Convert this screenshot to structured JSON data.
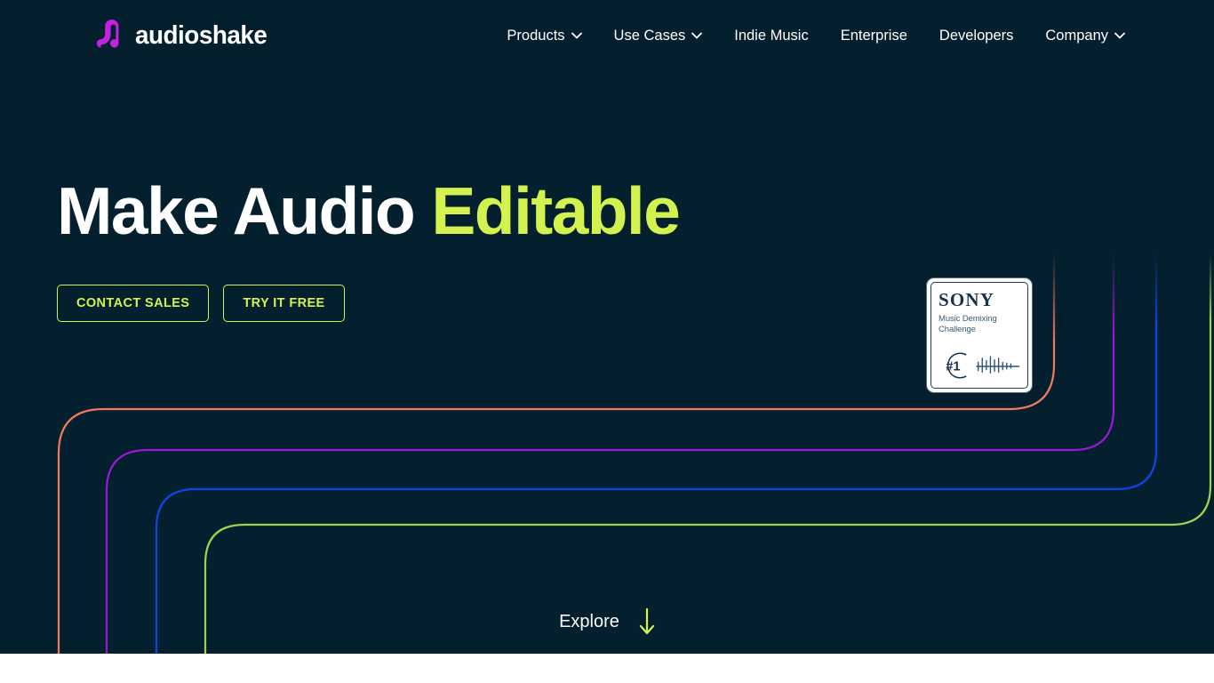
{
  "site": {
    "background_color": "#04202f",
    "accent_color": "#d4f24f",
    "logo_color": "#c521e0"
  },
  "header": {
    "logo": {
      "name": "audioshake",
      "wordmark": "audioshake",
      "icon": "audioshake-wave-icon"
    },
    "nav_items": [
      {
        "label": "Products",
        "has_dropdown": true,
        "icon": "chevron-down-icon"
      },
      {
        "label": "Use Cases",
        "has_dropdown": true,
        "icon": "chevron-down-icon"
      },
      {
        "label": "Indie Music",
        "has_dropdown": false
      },
      {
        "label": "Enterprise",
        "has_dropdown": false
      },
      {
        "label": "Developers",
        "has_dropdown": false
      },
      {
        "label": "Company",
        "has_dropdown": true,
        "icon": "chevron-down-icon"
      }
    ]
  },
  "hero": {
    "headline_plain": "Make Audio ",
    "headline_accent": "Editable",
    "buttons": [
      {
        "label": "CONTACT SALES"
      },
      {
        "label": "TRY IT FREE"
      }
    ],
    "badge": {
      "brand": "SONY",
      "line1": "Music Demixing",
      "line2": "Challenge",
      "rank": "#1",
      "icon": "waveform-icon"
    },
    "explore": {
      "label": "Explore",
      "icon": "arrow-down-icon"
    }
  },
  "decoration": {
    "lines": [
      {
        "color": "#f2795c",
        "name": "coral-line"
      },
      {
        "color": "#9a17d4",
        "name": "purple-line"
      },
      {
        "color": "#1044e8",
        "name": "blue-line"
      },
      {
        "color": "#a9cf4e",
        "name": "green-line"
      }
    ]
  }
}
